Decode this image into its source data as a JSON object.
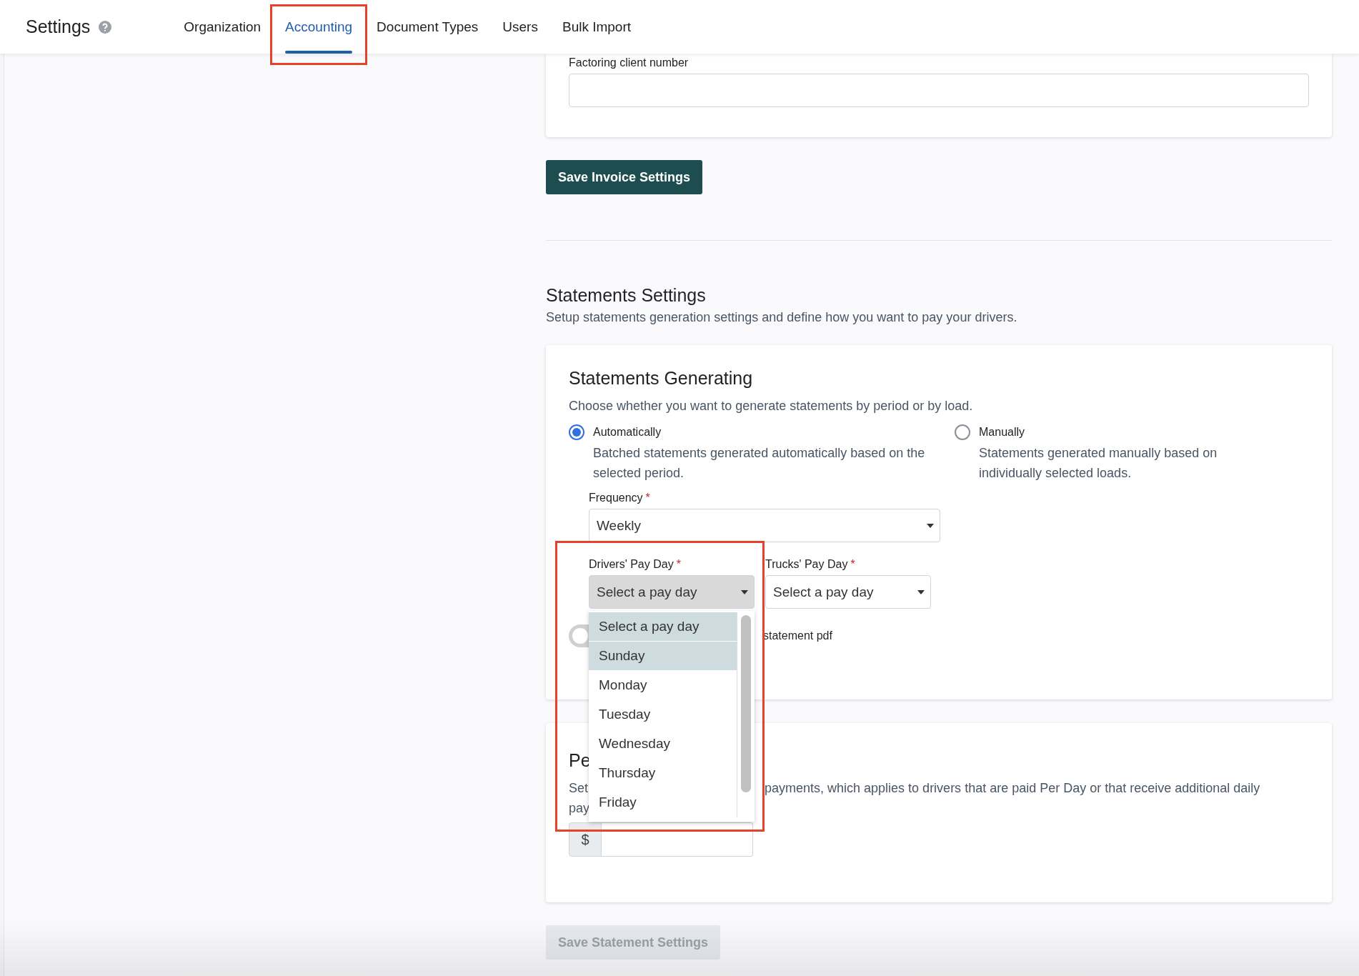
{
  "header": {
    "title": "Settings"
  },
  "tabs": [
    {
      "label": "Organization",
      "selected": false,
      "annotated": false
    },
    {
      "label": "Accounting",
      "selected": true,
      "annotated": true
    },
    {
      "label": "Document Types",
      "selected": false,
      "annotated": false
    },
    {
      "label": "Users",
      "selected": false,
      "annotated": false
    },
    {
      "label": "Bulk Import",
      "selected": false,
      "annotated": false
    }
  ],
  "invoice_card": {
    "field_label": "Factoring client number"
  },
  "save_invoice_button": {
    "label": "Save Invoice Settings",
    "disabled": false
  },
  "statements": {
    "title": "Statements Settings",
    "subtitle": "Setup statements generation settings and define how you want to pay your drivers."
  },
  "generating_card": {
    "title": "Statements Generating",
    "description": "Choose whether you want to generate statements by period or by load.",
    "options": [
      {
        "label": "Automatically",
        "description": "Batched statements generated automatically based on the selected period.",
        "selected": true
      },
      {
        "label": "Manually",
        "description": "Statements generated manually based on individually selected loads.",
        "selected": false
      }
    ],
    "frequency": {
      "label": "Frequency",
      "required_mark": "*",
      "value": "Weekly"
    },
    "pay_days": [
      {
        "label": "Drivers' Pay Day",
        "required_mark": "*",
        "value": "Select a pay day",
        "open": true,
        "annotated": true,
        "options": [
          {
            "label": "Select a pay day",
            "highlighted": true
          },
          {
            "label": "Sunday",
            "highlighted": true
          },
          {
            "label": "Monday",
            "highlighted": false
          },
          {
            "label": "Tuesday",
            "highlighted": false
          },
          {
            "label": "Wednesday",
            "highlighted": false
          },
          {
            "label": "Thursday",
            "highlighted": false
          },
          {
            "label": "Friday",
            "highlighted": false
          }
        ]
      },
      {
        "label": "Trucks' Pay Day",
        "required_mark": "*",
        "value": "Select a pay day",
        "open": false,
        "annotated": false
      }
    ],
    "toggle": {
      "label": "statement pdf",
      "on": false
    }
  },
  "per_day_card": {
    "title": "Pe",
    "description_parts": [
      "Set",
      "payments, which applies to drivers that are paid Per Day or that receive additional daily",
      "pay"
    ],
    "currency": "$"
  },
  "save_statement_button": {
    "label": "Save Statement Settings",
    "disabled": true
  }
}
